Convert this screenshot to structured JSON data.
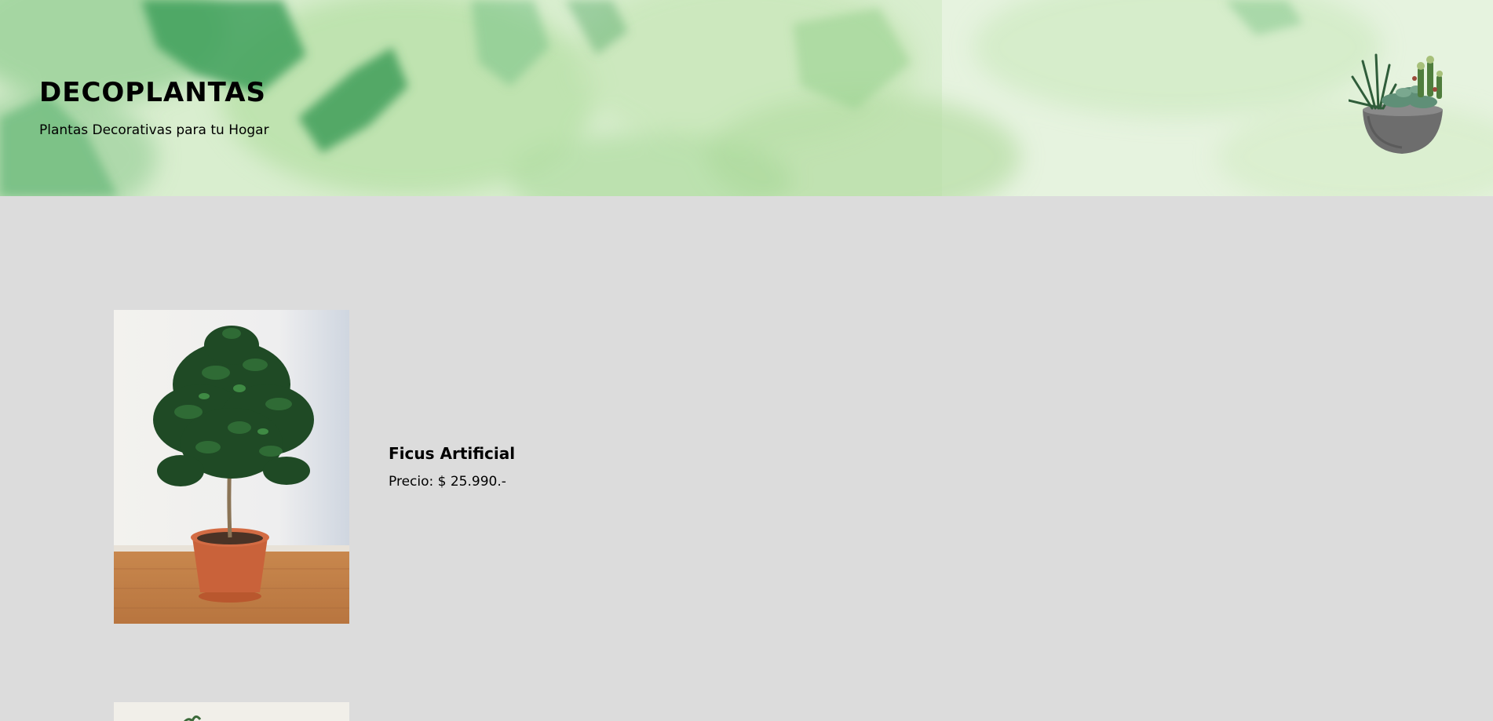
{
  "header": {
    "title": "DECOPLANTAS",
    "subtitle": "Plantas Decorativas para tu Hogar",
    "logo_icon": "succulent-bowl-icon"
  },
  "products": [
    {
      "name": "Ficus Artificial",
      "price": "Precio: $ 25.990.-",
      "image_icon": "ficus-plant-image"
    }
  ],
  "colors": {
    "page_background": "#dcdcdc",
    "header_green_dark": "#3d9a5a",
    "header_green_light": "#cfe8c3"
  }
}
